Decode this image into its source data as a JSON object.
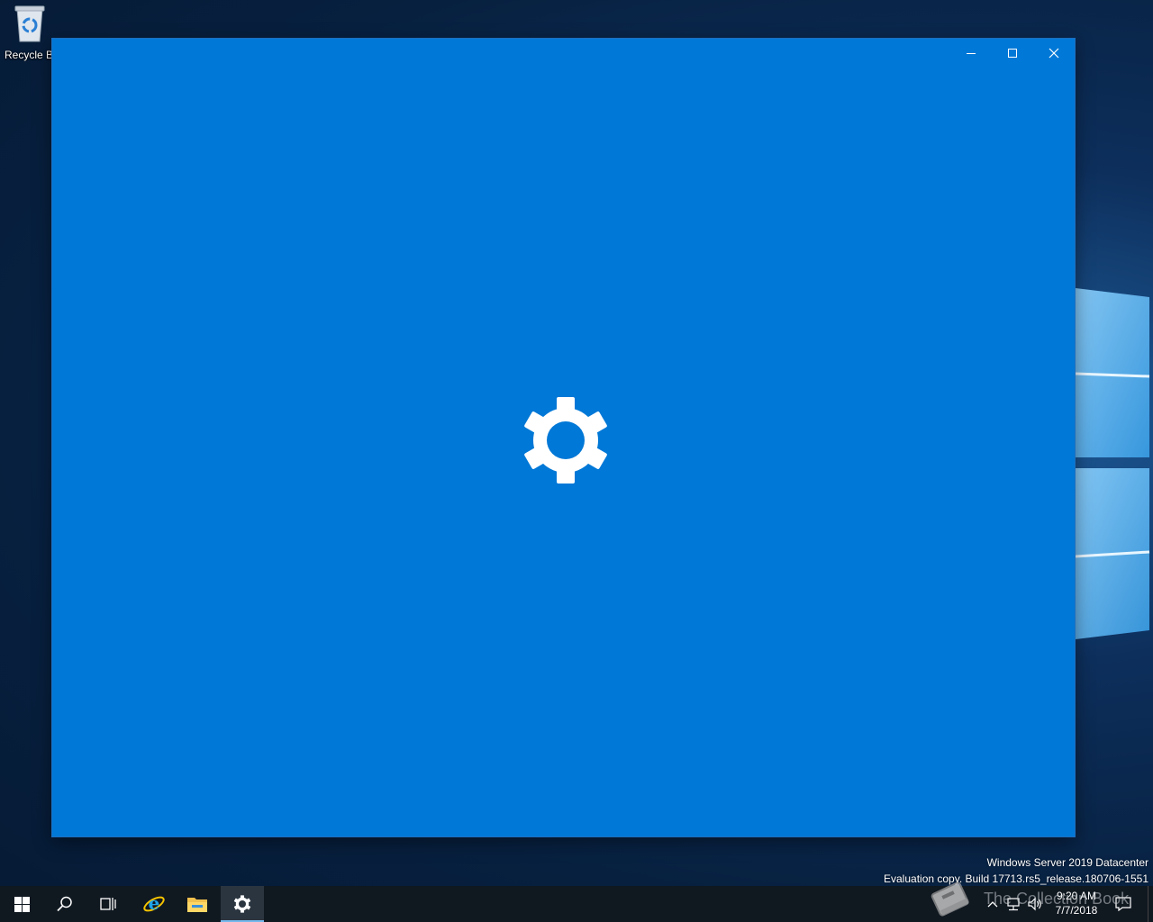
{
  "desktop": {
    "recycle_bin_label": "Recycle B",
    "watermark_line1": "Windows Server 2019 Datacenter",
    "watermark_line2": "Evaluation copy. Build 17713.rs5_release.180706-1551"
  },
  "window": {
    "accent_color": "#0078d7",
    "splash_icon": "gear-icon",
    "controls": [
      "minimize",
      "maximize",
      "close"
    ]
  },
  "taskbar": {
    "items": [
      "start",
      "search",
      "task-view",
      "internet-explorer",
      "file-explorer",
      "settings"
    ],
    "active_item": "settings",
    "clock_time": "9:20 AM",
    "clock_date": "7/7/2018",
    "overlay_text": "The Collection Book"
  }
}
